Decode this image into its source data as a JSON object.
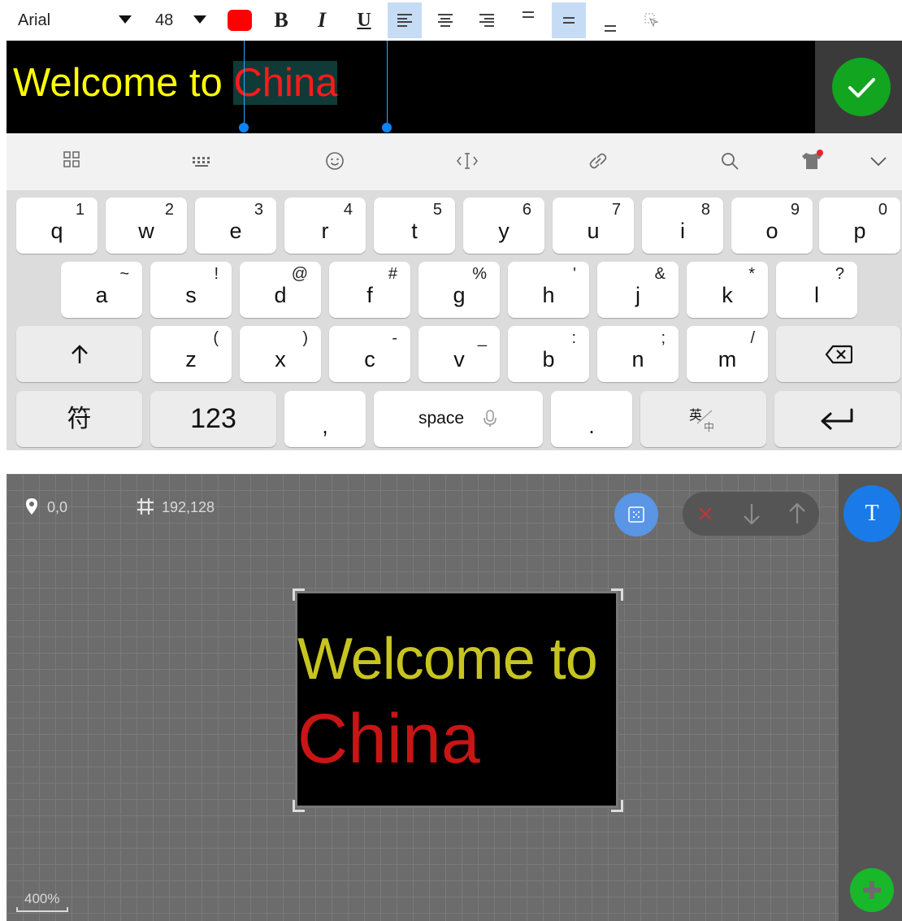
{
  "toolbar": {
    "font_family": "Arial",
    "font_size": "48",
    "bold": "B",
    "italic": "I",
    "underline": "U",
    "text_color": "#ff0000"
  },
  "editor": {
    "text_part1": "Welcome to ",
    "text_part2": "China"
  },
  "keyboard": {
    "row1": [
      {
        "main": "q",
        "sub": "1"
      },
      {
        "main": "w",
        "sub": "2"
      },
      {
        "main": "e",
        "sub": "3"
      },
      {
        "main": "r",
        "sub": "4"
      },
      {
        "main": "t",
        "sub": "5"
      },
      {
        "main": "y",
        "sub": "6"
      },
      {
        "main": "u",
        "sub": "7"
      },
      {
        "main": "i",
        "sub": "8"
      },
      {
        "main": "o",
        "sub": "9"
      },
      {
        "main": "p",
        "sub": "0"
      }
    ],
    "row2": [
      {
        "main": "a",
        "sub": "~"
      },
      {
        "main": "s",
        "sub": "!"
      },
      {
        "main": "d",
        "sub": "@"
      },
      {
        "main": "f",
        "sub": "#"
      },
      {
        "main": "g",
        "sub": "%"
      },
      {
        "main": "h",
        "sub": "'"
      },
      {
        "main": "j",
        "sub": "&"
      },
      {
        "main": "k",
        "sub": "*"
      },
      {
        "main": "l",
        "sub": "?"
      }
    ],
    "row3": [
      {
        "main": "z",
        "sub": "("
      },
      {
        "main": "x",
        "sub": ")"
      },
      {
        "main": "c",
        "sub": "-"
      },
      {
        "main": "v",
        "sub": "_"
      },
      {
        "main": "b",
        "sub": ":"
      },
      {
        "main": "n",
        "sub": ";"
      },
      {
        "main": "m",
        "sub": "/"
      }
    ],
    "symbols_label": "符",
    "numbers_label": "123",
    "comma_label": ",",
    "space_label": "space",
    "period_label": ".",
    "lang_top": "英",
    "lang_bottom": "中"
  },
  "canvas": {
    "position_label": "0,0",
    "size_label": "192,128",
    "zoom_label": "400%",
    "preview_line1": "Welcome to",
    "preview_line2": "China",
    "text_tool_label": "T"
  }
}
